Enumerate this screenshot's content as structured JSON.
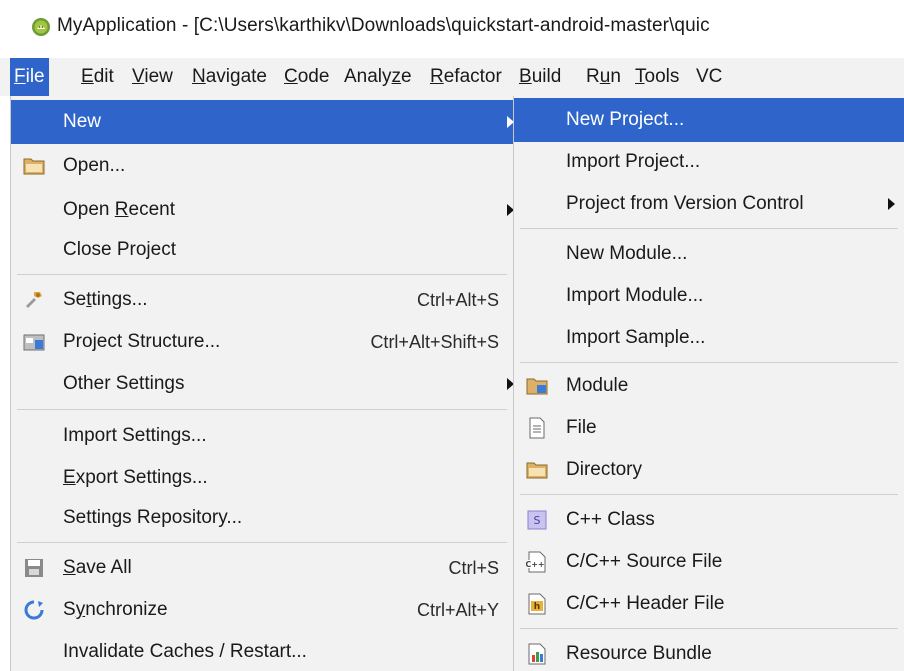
{
  "window": {
    "title": "MyApplication - [C:\\Users\\karthikv\\Downloads\\quickstart-android-master\\quic",
    "app_icon": "android-studio-icon"
  },
  "menubar": {
    "items": [
      {
        "pre": "",
        "u": "F",
        "post": "ile",
        "active": true
      },
      {
        "pre": "",
        "u": "E",
        "post": "dit"
      },
      {
        "pre": "",
        "u": "V",
        "post": "iew"
      },
      {
        "pre": "",
        "u": "N",
        "post": "avigate"
      },
      {
        "pre": "",
        "u": "C",
        "post": "ode"
      },
      {
        "pre": "Analy",
        "u": "z",
        "post": "e"
      },
      {
        "pre": "",
        "u": "R",
        "post": "efactor"
      },
      {
        "pre": "",
        "u": "B",
        "post": "uild"
      },
      {
        "pre": "R",
        "u": "u",
        "post": "n"
      },
      {
        "pre": "",
        "u": "T",
        "post": "ools"
      },
      {
        "pre": "VC",
        "u": "",
        "post": ""
      }
    ]
  },
  "file_menu": {
    "new": {
      "label": "New"
    },
    "open": {
      "label": "Open...",
      "icon": "folder-icon"
    },
    "open_recent": {
      "pre": "Open ",
      "u": "R",
      "post": "ecent"
    },
    "close_project": {
      "label": "Close Project"
    },
    "settings": {
      "pre": "Se",
      "u": "t",
      "post": "tings...",
      "shortcut": "Ctrl+Alt+S",
      "icon": "wrench-icon"
    },
    "project_structure": {
      "label": "Project Structure...",
      "shortcut": "Ctrl+Alt+Shift+S",
      "icon": "project-structure-icon"
    },
    "other_settings": {
      "label": "Other Settings"
    },
    "import_settings": {
      "label": "Import Settings..."
    },
    "export_settings": {
      "pre": "",
      "u": "E",
      "post": "xport Settings..."
    },
    "settings_repository": {
      "label": "Settings Repository..."
    },
    "save_all": {
      "pre": "",
      "u": "S",
      "post": "ave All",
      "shortcut": "Ctrl+S",
      "icon": "save-icon"
    },
    "synchronize": {
      "pre": "S",
      "u": "y",
      "post": "nchronize",
      "shortcut": "Ctrl+Alt+Y",
      "icon": "sync-icon"
    },
    "invalidate": {
      "label": "Invalidate Caches / Restart..."
    }
  },
  "new_submenu": {
    "new_project": {
      "label": "New Project..."
    },
    "import_project": {
      "label": "Import Project..."
    },
    "project_from_vcs": {
      "label": "Project from Version Control"
    },
    "new_module": {
      "label": "New Module..."
    },
    "import_module": {
      "label": "Import Module..."
    },
    "import_sample": {
      "label": "Import Sample..."
    },
    "module": {
      "label": "Module",
      "icon": "module-icon"
    },
    "file": {
      "label": "File",
      "icon": "file-icon"
    },
    "directory": {
      "label": "Directory",
      "icon": "folder-icon"
    },
    "cpp_class": {
      "label": "C++ Class",
      "icon": "cpp-class-icon",
      "badge": "S"
    },
    "cpp_source": {
      "label": "C/C++ Source File",
      "icon": "cpp-source-icon",
      "badge": "C++"
    },
    "cpp_header": {
      "label": "C/C++ Header File",
      "icon": "cpp-header-icon",
      "badge": "h"
    },
    "resource_bundle": {
      "label": "Resource Bundle",
      "icon": "resource-bundle-icon"
    }
  },
  "colors": {
    "highlight": "#2f65ca",
    "menu_bg": "#f2f2f2",
    "folder": "#dcb067"
  }
}
